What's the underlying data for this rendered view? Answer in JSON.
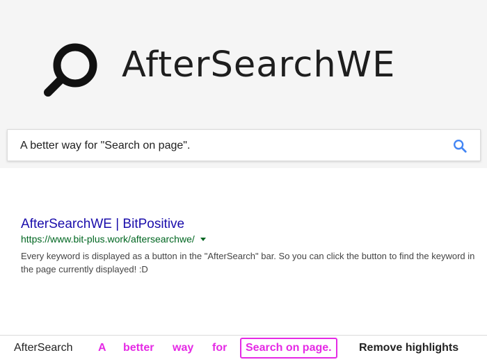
{
  "header": {
    "logo_icon": "magnifier-icon",
    "title": "AfterSearchWE"
  },
  "search": {
    "query": "A better way for \"Search on page\".",
    "icon": "search-icon",
    "icon_color": "#4285f4"
  },
  "result": {
    "title": "AfterSearchWE | BitPositive",
    "url": "https://www.bit-plus.work/aftersearchwe/",
    "description": "Every keyword is displayed as a button in the \"AfterSearch\" bar. So you can click the button to find the keyword in the page currently displayed! :D"
  },
  "aftersearch_bar": {
    "label": "AfterSearch",
    "keywords": [
      "A",
      "better",
      "way",
      "for"
    ],
    "phrase_keyword": "Search on page.",
    "remove_label": "Remove highlights",
    "keyword_color": "#e52ae5"
  }
}
